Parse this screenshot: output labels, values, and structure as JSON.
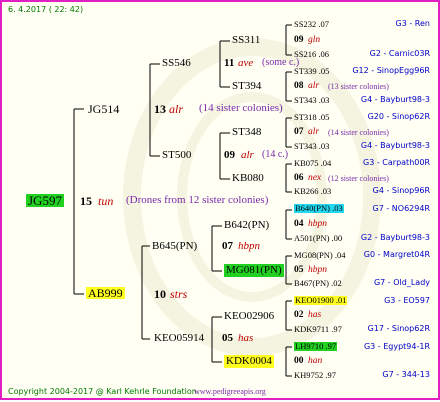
{
  "date": "6. 4.2017 ( 22: 42)",
  "copyright": "Copyright 2004-2017 @ Karl Kehrle Foundation.",
  "website": "www.pedigreeapis.org",
  "root": {
    "name": "JG597",
    "gen": "15",
    "race": "tun",
    "note": "(Drones from 12 sister colonies)"
  },
  "gen1": {
    "sire": {
      "name": "JG514",
      "gen": "13",
      "race": "alr",
      "note": "(14 sister colonies)"
    },
    "dam": {
      "name": "AB999",
      "gen": "10",
      "race": "strs"
    }
  },
  "gen2": {
    "ss546": {
      "name": "SS546",
      "gen": "11",
      "race": "ave",
      "note": "(some c.)"
    },
    "st500": {
      "name": "ST500",
      "gen": "09",
      "race": "alr",
      "note": "(14 c.)"
    },
    "b645": {
      "name": "B645(PN)",
      "gen": "07",
      "race": "hbpn"
    },
    "keo05914": {
      "name": "KEO05914",
      "gen": "05",
      "race": "has"
    }
  },
  "gen3": {
    "ss311": {
      "name": "SS311",
      "gen": "09",
      "race": "gln"
    },
    "st394": {
      "name": "ST394",
      "gen": "08",
      "race": "alr",
      "note": "(13 sister colonies)"
    },
    "st348": {
      "name": "ST348",
      "gen": "07",
      "race": "alr",
      "note": "(14 sister colonies)"
    },
    "kb080": {
      "name": "KB080",
      "gen": "06",
      "race": "nex",
      "note": "(12 sister colonies)"
    },
    "b642": {
      "name": "B642(PN)",
      "gen": "04",
      "race": "hbpn"
    },
    "mg081": {
      "name": "MG081(PN)",
      "gen": "05",
      "race": "hbpn"
    },
    "keo02906": {
      "name": "KEO02906",
      "gen": "02",
      "race": "has"
    },
    "kdk0004": {
      "name": "KDK0004",
      "gen": "00",
      "race": "han"
    }
  },
  "gen4": [
    {
      "id": "SS232 .07",
      "ref": "G3 - Ren"
    },
    {
      "id": "SS216 .06",
      "ref": "G2 - Carnic03R"
    },
    {
      "id": "ST339 .05",
      "ref": "G12 - SinopEgg96R"
    },
    {
      "id": "ST343 .03",
      "ref": "G4 - Bayburt98-3"
    },
    {
      "id": "ST318 .05",
      "ref": "G20 - Sinop62R"
    },
    {
      "id": "ST343 .03",
      "ref": "G4 - Bayburt98-3"
    },
    {
      "id": "KB075 .04",
      "ref": "G3 - Carpath00R"
    },
    {
      "id": "KB266 .03",
      "ref": "G4 - Sinop96R"
    },
    {
      "id": "B640(PN) .03",
      "ref": "G7 - NO6294R"
    },
    {
      "id": "A501(PN) .00",
      "ref": "G2 - Bayburt98-3"
    },
    {
      "id": "MG08(PN) .04",
      "ref": "G0 - Margret04R"
    },
    {
      "id": "B467(PN) .02",
      "ref": "G7 - Old_Lady"
    },
    {
      "id": "KEO01900 .01",
      "ref": "G3 - EO597"
    },
    {
      "id": "KDK9711 .97",
      "ref": "G17 - Sinop62R"
    },
    {
      "id": "LH9710 .97",
      "ref": "G3 - Egypt94-1R"
    },
    {
      "id": "KH9752 .97",
      "ref": "G7 - 344-13"
    }
  ]
}
